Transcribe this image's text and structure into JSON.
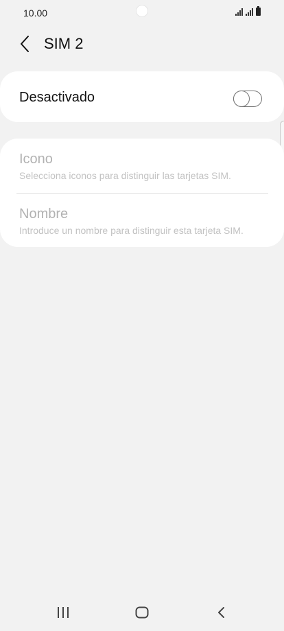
{
  "status_bar": {
    "time": "10.00",
    "icons": [
      "signal-sim1-icon",
      "signal-sim2-icon",
      "battery-icon"
    ]
  },
  "header": {
    "back_icon": "chevron-left-icon",
    "title": "SIM 2"
  },
  "sim_toggle": {
    "label": "Desactivado",
    "enabled": false
  },
  "settings_list": [
    {
      "title": "Icono",
      "subtitle": "Selecciona iconos para distinguir las tarjetas SIM."
    },
    {
      "title": "Nombre",
      "subtitle": "Introduce un nombre para distinguir esta tarjeta SIM."
    }
  ],
  "nav_bar": {
    "icons": [
      "recent-apps-icon",
      "home-icon",
      "back-icon"
    ]
  },
  "colors": {
    "background": "#f2f2f2",
    "card": "#ffffff",
    "disabled_text": "#b2b2b2",
    "switch_outline": "#757575"
  }
}
